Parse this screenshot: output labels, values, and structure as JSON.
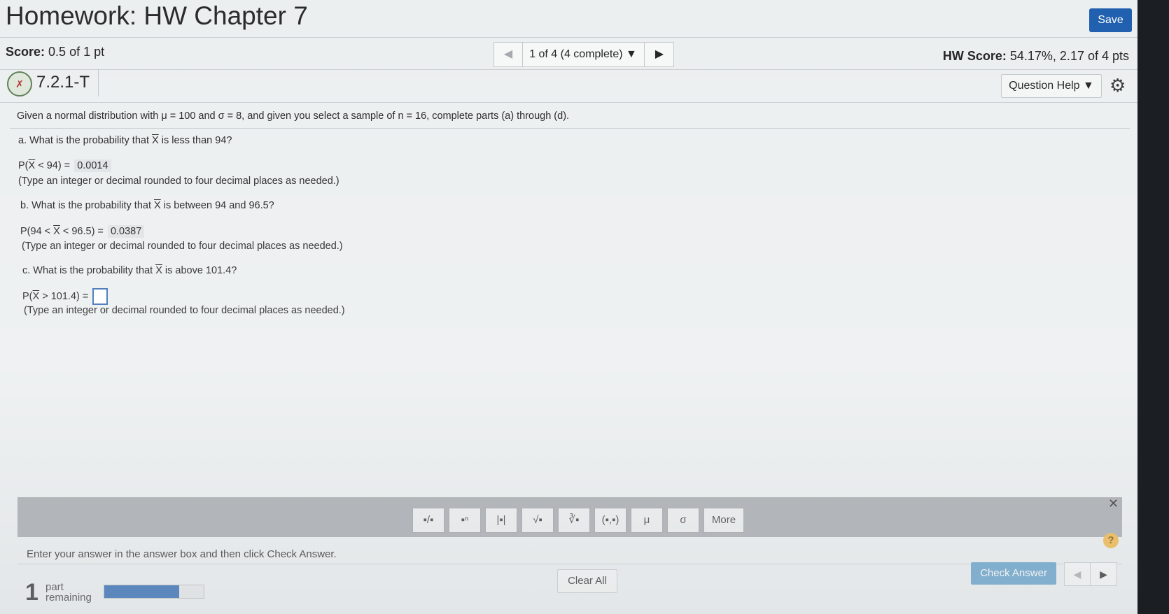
{
  "header": {
    "title": "Homework: HW Chapter 7",
    "save_label": "Save"
  },
  "scorebar": {
    "score_label": "Score:",
    "score_value": "0.5 of 1 pt",
    "nav_prev": "◀",
    "nav_selector": "1 of 4 (4 complete) ▼",
    "nav_next": "▶",
    "hw_score_label": "HW Score:",
    "hw_score_value": "54.17%, 2.17 of 4 pts"
  },
  "question_bar": {
    "status_icon": "partial-correct-icon",
    "status_glyph": "✗",
    "question_id": "7.2.1-T",
    "help_label": "Question Help ▼",
    "gear_glyph": "⚙"
  },
  "question": {
    "prompt": "Given a normal distribution with μ = 100 and σ = 8, and given you select a sample of n = 16, complete parts (a) through (d).",
    "part_a": {
      "q_prefix": "a. What is the probability that ",
      "q_suffix": " is less than 94?",
      "ans_prefix": "P(",
      "ans_suffix": " < 94) =",
      "answer": "0.0014",
      "hint": "(Type an integer or decimal rounded to four decimal places as needed.)"
    },
    "part_b": {
      "q_prefix": "b. What is the probability that ",
      "q_suffix": " is between 94 and 96.5?",
      "ans_prefix": "P(94 < ",
      "ans_suffix": " < 96.5) =",
      "answer": "0.0387",
      "hint": "(Type an integer or decimal rounded to four decimal places as needed.)"
    },
    "part_c": {
      "q_prefix": "c. What is the probability that ",
      "q_suffix": " is above 101.4?",
      "ans_prefix": "P(",
      "ans_suffix": " > 101.4) =",
      "hint": "(Type an integer or decimal rounded to four decimal places as needed.)"
    },
    "xbar": "X"
  },
  "toolbar": {
    "tools": [
      "▪/▪",
      "▪ⁿ",
      "|▪|",
      "√▪",
      "∛▪",
      "(▪,▪)",
      "μ",
      "σ",
      "More"
    ],
    "close": "✕",
    "help": "?"
  },
  "footer": {
    "instruction": "Enter your answer in the answer box and then click Check Answer.",
    "parts_remaining_count": "1",
    "parts_remaining_word1": "part",
    "parts_remaining_word2": "remaining",
    "progress_fraction": 0.75,
    "clear_label": "Clear All",
    "check_label": "Check Answer",
    "pager_prev": "◀",
    "pager_next": "▶"
  }
}
